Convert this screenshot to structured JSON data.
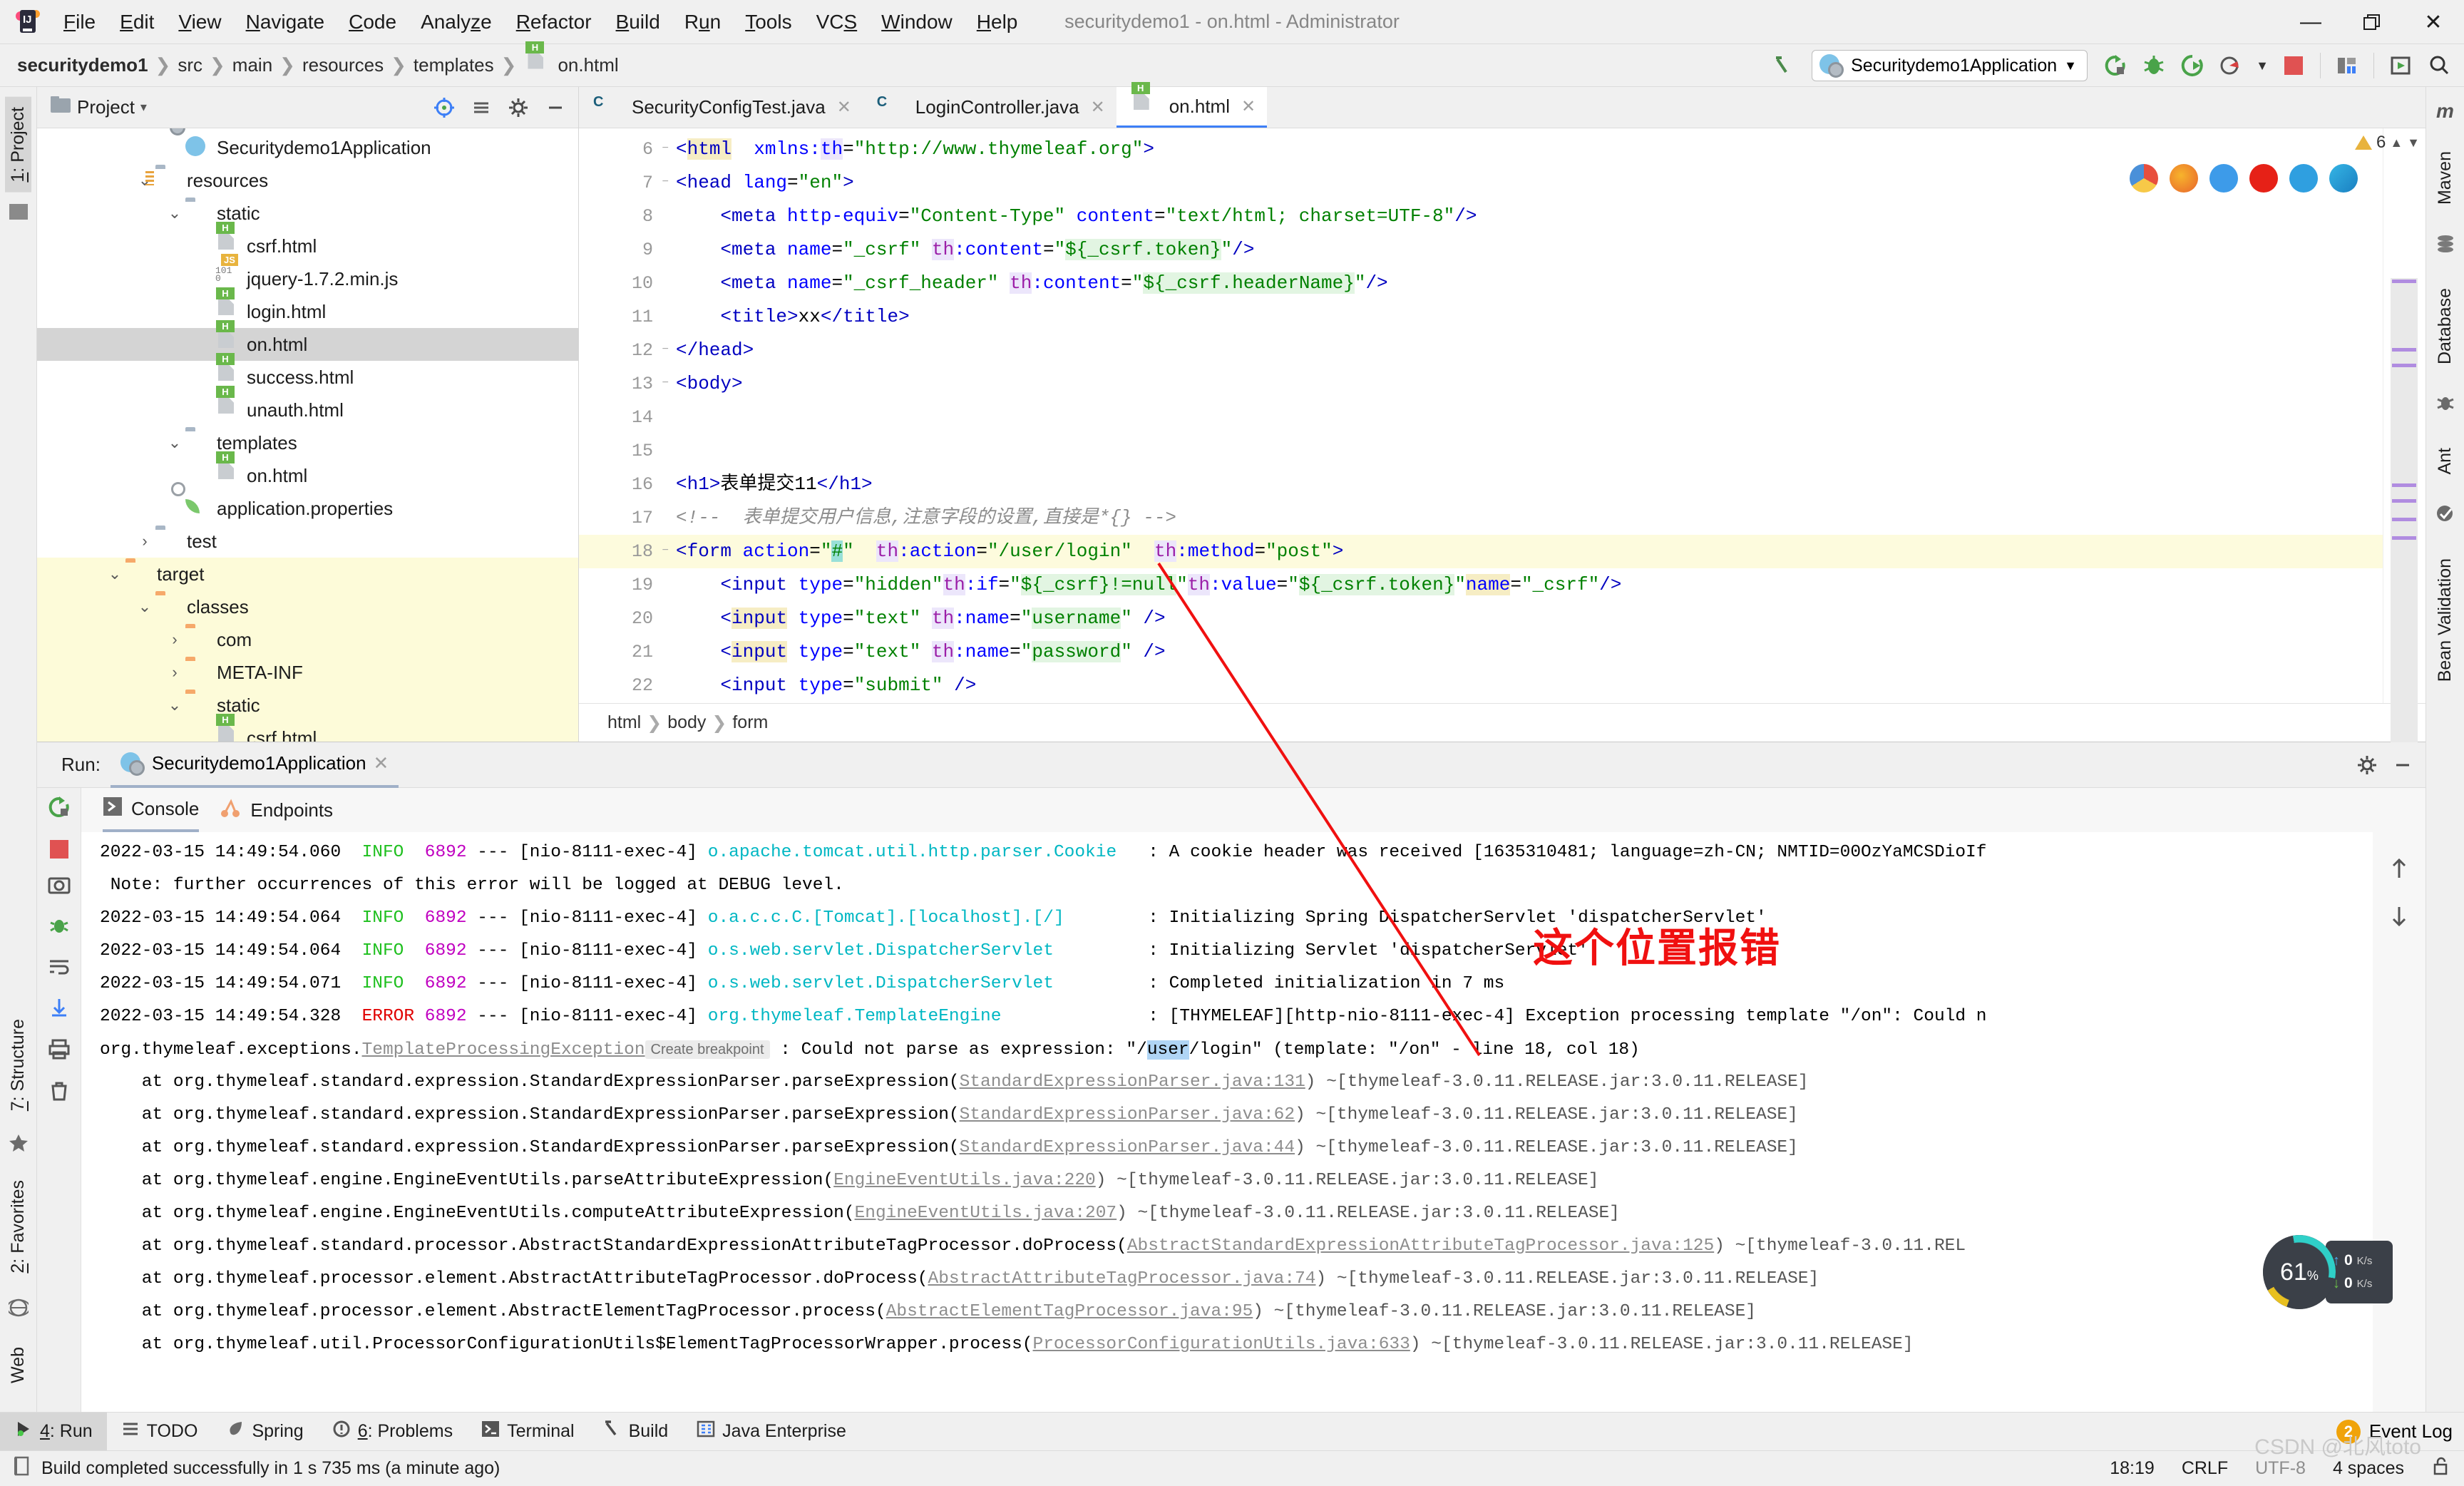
{
  "window": {
    "title": "securitydemo1 - on.html - Administrator",
    "controls": {
      "minimize": "—",
      "maximize": "❐",
      "close": "✕"
    }
  },
  "menubar": [
    {
      "label": "File",
      "mnemonic": "F"
    },
    {
      "label": "Edit",
      "mnemonic": "E"
    },
    {
      "label": "View",
      "mnemonic": "V"
    },
    {
      "label": "Navigate",
      "mnemonic": "N"
    },
    {
      "label": "Code",
      "mnemonic": "C"
    },
    {
      "label": "Analyze",
      "mnemonic": "z"
    },
    {
      "label": "Refactor",
      "mnemonic": "R"
    },
    {
      "label": "Build",
      "mnemonic": "B"
    },
    {
      "label": "Run",
      "mnemonic": "u"
    },
    {
      "label": "Tools",
      "mnemonic": "T"
    },
    {
      "label": "VCS",
      "mnemonic": "S"
    },
    {
      "label": "Window",
      "mnemonic": "W"
    },
    {
      "label": "Help",
      "mnemonic": "H"
    }
  ],
  "navbar": {
    "crumbs": [
      "securitydemo1",
      "src",
      "main",
      "resources",
      "templates",
      "on.html"
    ],
    "separator": "❯",
    "run_config": "Securitydemo1Application",
    "run_config_caret": "▼"
  },
  "project_panel": {
    "title": "Project",
    "title_caret": "▾",
    "tree": [
      {
        "label": "Securitydemo1Application",
        "indent": 4,
        "arrow": "none",
        "icon": "spring-app-icon",
        "state": "normal"
      },
      {
        "label": "resources",
        "indent": 3,
        "arrow": "down",
        "icon": "resources-folder-icon",
        "state": "normal"
      },
      {
        "label": "static",
        "indent": 4,
        "arrow": "down",
        "icon": "folder-icon",
        "state": "normal"
      },
      {
        "label": "csrf.html",
        "indent": 5,
        "arrow": "none",
        "icon": "html-file-icon",
        "state": "normal"
      },
      {
        "label": "jquery-1.7.2.min.js",
        "indent": 5,
        "arrow": "none",
        "icon": "js-file-icon",
        "state": "normal"
      },
      {
        "label": "login.html",
        "indent": 5,
        "arrow": "none",
        "icon": "html-file-icon",
        "state": "normal"
      },
      {
        "label": "on.html",
        "indent": 5,
        "arrow": "none",
        "icon": "html-file-icon",
        "state": "selected"
      },
      {
        "label": "success.html",
        "indent": 5,
        "arrow": "none",
        "icon": "html-file-icon",
        "state": "normal"
      },
      {
        "label": "unauth.html",
        "indent": 5,
        "arrow": "none",
        "icon": "html-file-icon",
        "state": "normal"
      },
      {
        "label": "templates",
        "indent": 4,
        "arrow": "down",
        "icon": "folder-icon",
        "state": "normal"
      },
      {
        "label": "on.html",
        "indent": 5,
        "arrow": "none",
        "icon": "html-file-icon",
        "state": "normal"
      },
      {
        "label": "application.properties",
        "indent": 4,
        "arrow": "none",
        "icon": "spring-properties-icon",
        "state": "normal"
      },
      {
        "label": "test",
        "indent": 3,
        "arrow": "right",
        "icon": "folder-icon",
        "state": "normal"
      },
      {
        "label": "target",
        "indent": 2,
        "arrow": "down",
        "icon": "folder-orange-icon",
        "state": "target"
      },
      {
        "label": "classes",
        "indent": 3,
        "arrow": "down",
        "icon": "folder-orange-icon",
        "state": "target"
      },
      {
        "label": "com",
        "indent": 4,
        "arrow": "right",
        "icon": "folder-orange-icon",
        "state": "target"
      },
      {
        "label": "META-INF",
        "indent": 4,
        "arrow": "right",
        "icon": "folder-orange-icon",
        "state": "target"
      },
      {
        "label": "static",
        "indent": 4,
        "arrow": "down",
        "icon": "folder-orange-icon",
        "state": "target"
      },
      {
        "label": "csrf.html",
        "indent": 5,
        "arrow": "none",
        "icon": "html-file-icon",
        "state": "target"
      }
    ]
  },
  "editor": {
    "tabs": [
      {
        "label": "SecurityConfigTest.java",
        "icon": "java-class-icon",
        "active": false,
        "close": "✕"
      },
      {
        "label": "LoginController.java",
        "icon": "java-class-icon",
        "active": false,
        "close": "✕"
      },
      {
        "label": "on.html",
        "icon": "html-file-icon",
        "active": true,
        "close": "✕"
      }
    ],
    "warning_count": "6",
    "lines": [
      {
        "n": "6",
        "highlight": false
      },
      {
        "n": "7",
        "highlight": false
      },
      {
        "n": "8",
        "highlight": false
      },
      {
        "n": "9",
        "highlight": false
      },
      {
        "n": "10",
        "highlight": false
      },
      {
        "n": "11",
        "highlight": false
      },
      {
        "n": "12",
        "highlight": false
      },
      {
        "n": "13",
        "highlight": false
      },
      {
        "n": "14",
        "highlight": false
      },
      {
        "n": "15",
        "highlight": false
      },
      {
        "n": "16",
        "highlight": false
      },
      {
        "n": "17",
        "highlight": false
      },
      {
        "n": "18",
        "highlight": true
      },
      {
        "n": "19",
        "highlight": false
      },
      {
        "n": "20",
        "highlight": false
      },
      {
        "n": "21",
        "highlight": false
      },
      {
        "n": "22",
        "highlight": false
      }
    ],
    "source": [
      "<html  xmlns:th=\"http://www.thymeleaf.org\">",
      "<head lang=\"en\">",
      "    <meta http-equiv=\"Content-Type\" content=\"text/html; charset=UTF-8\"/>",
      "    <meta name=\"_csrf\" th:content=\"${_csrf.token}\"/>",
      "    <meta name=\"_csrf_header\" th:content=\"${_csrf.headerName}\"/>",
      "    <title>xx</title>",
      "</head>",
      "<body>",
      "",
      "",
      "<h1>表单提交11</h1>",
      "<!--  表单提交用户信息,注意字段的设置,直接是*{} -->",
      "<form action=\"#\"  th:action=\"/user/login\"  th:method=\"post\">",
      "    <input type=\"hidden\"th:if=\"${_csrf}!=null\"th:value=\"${_csrf.token}\"name=\"_csrf\"/>",
      "    <input type=\"text\" th:name=\"username\" />",
      "    <input type=\"text\" th:name=\"password\" />",
      "    <input type=\"submit\" />"
    ],
    "breadcrumbs": [
      "html",
      "body",
      "form"
    ]
  },
  "run_panel": {
    "label": "Run:",
    "config_name": "Securitydemo1Application",
    "close": "✕",
    "tabs": [
      {
        "label": "Console",
        "active": true,
        "icon": "console-icon"
      },
      {
        "label": "Endpoints",
        "active": false,
        "icon": "endpoints-icon"
      }
    ],
    "log": [
      {
        "type": "info",
        "date": "2022-03-15 14:49:54.060",
        "level": "INFO ",
        "pid": "6892",
        "thread": "[nio-8111-exec-4]",
        "logger": "o.apache.tomcat.util.http.parser.Cookie",
        "msg": ": A cookie header was received [1635310481; language=zh-CN; NMTID=00OzYaMCSDioIf"
      },
      {
        "type": "plain",
        "text": " Note: further occurrences of this error will be logged at DEBUG level."
      },
      {
        "type": "info",
        "date": "2022-03-15 14:49:54.064",
        "level": "INFO ",
        "pid": "6892",
        "thread": "[nio-8111-exec-4]",
        "logger": "o.a.c.c.C.[Tomcat].[localhost].[/]",
        "msg": ": Initializing Spring DispatcherServlet 'dispatcherServlet'"
      },
      {
        "type": "info",
        "date": "2022-03-15 14:49:54.064",
        "level": "INFO ",
        "pid": "6892",
        "thread": "[nio-8111-exec-4]",
        "logger": "o.s.web.servlet.DispatcherServlet",
        "msg": ": Initializing Servlet 'dispatcherServlet'"
      },
      {
        "type": "info",
        "date": "2022-03-15 14:49:54.071",
        "level": "INFO ",
        "pid": "6892",
        "thread": "[nio-8111-exec-4]",
        "logger": "o.s.web.servlet.DispatcherServlet",
        "msg": ": Completed initialization in 7 ms"
      },
      {
        "type": "error",
        "date": "2022-03-15 14:49:54.328",
        "level": "ERROR",
        "pid": "6892",
        "thread": "[nio-8111-exec-4]",
        "logger": "org.thymeleaf.TemplateEngine",
        "msg": ": [THYMELEAF][http-nio-8111-exec-4] Exception processing template \"/on\": Could n"
      }
    ],
    "exception": {
      "prefix": "org.thymeleaf.exceptions.",
      "link": "TemplateProcessingException",
      "breakpoint_hint": "Create breakpoint",
      "rest_a": " : Could not parse as expression: \"/",
      "selected": "user",
      "rest_b": "/login\" (template: \"/on\" - line 18, col 18)"
    },
    "stack": [
      {
        "pre": "    at org.thymeleaf.standard.expression.StandardExpressionParser.parseExpression(",
        "link": "StandardExpressionParser.java:131",
        "post": ") ~[thymeleaf-3.0.11.RELEASE.jar:3.0.11.RELEASE]"
      },
      {
        "pre": "    at org.thymeleaf.standard.expression.StandardExpressionParser.parseExpression(",
        "link": "StandardExpressionParser.java:62",
        "post": ") ~[thymeleaf-3.0.11.RELEASE.jar:3.0.11.RELEASE]"
      },
      {
        "pre": "    at org.thymeleaf.standard.expression.StandardExpressionParser.parseExpression(",
        "link": "StandardExpressionParser.java:44",
        "post": ") ~[thymeleaf-3.0.11.RELEASE.jar:3.0.11.RELEASE]"
      },
      {
        "pre": "    at org.thymeleaf.engine.EngineEventUtils.parseAttributeExpression(",
        "link": "EngineEventUtils.java:220",
        "post": ") ~[thymeleaf-3.0.11.RELEASE.jar:3.0.11.RELEASE]"
      },
      {
        "pre": "    at org.thymeleaf.engine.EngineEventUtils.computeAttributeExpression(",
        "link": "EngineEventUtils.java:207",
        "post": ") ~[thymeleaf-3.0.11.RELEASE.jar:3.0.11.RELEASE]"
      },
      {
        "pre": "    at org.thymeleaf.standard.processor.AbstractStandardExpressionAttributeTagProcessor.doProcess(",
        "link": "AbstractStandardExpressionAttributeTagProcessor.java:125",
        "post": ") ~[thymeleaf-3.0.11.REL"
      },
      {
        "pre": "    at org.thymeleaf.processor.element.AbstractAttributeTagProcessor.doProcess(",
        "link": "AbstractAttributeTagProcessor.java:74",
        "post": ") ~[thymeleaf-3.0.11.RELEASE.jar:3.0.11.RELEASE]"
      },
      {
        "pre": "    at org.thymeleaf.processor.element.AbstractElementTagProcessor.process(",
        "link": "AbstractElementTagProcessor.java:95",
        "post": ") ~[thymeleaf-3.0.11.RELEASE.jar:3.0.11.RELEASE]"
      },
      {
        "pre": "    at org.thymeleaf.util.ProcessorConfigurationUtils$ElementTagProcessorWrapper.process(",
        "link": "ProcessorConfigurationUtils.java:633",
        "post": ") ~[thymeleaf-3.0.11.RELEASE.jar:3.0.11.RELEASE]"
      }
    ]
  },
  "left_strip": [
    {
      "label": "1: Project",
      "mnemonic": "1",
      "active": true
    },
    {
      "label": "7: Structure",
      "mnemonic": "7",
      "active": false
    },
    {
      "label": "2: Favorites",
      "mnemonic": "2",
      "active": false
    },
    {
      "label": "Web",
      "mnemonic": "",
      "active": false
    }
  ],
  "right_strip": [
    {
      "label": "Maven",
      "icon": "maven-icon"
    },
    {
      "label": "Database",
      "icon": "database-icon"
    },
    {
      "label": "Ant",
      "icon": "ant-icon"
    },
    {
      "label": "Bean Validation",
      "icon": "bean-validation-icon"
    }
  ],
  "toolwindow_bar": [
    {
      "label": "4: Run",
      "mnemonic": "4",
      "icon": "run-icon",
      "active": true
    },
    {
      "label": "TODO",
      "mnemonic": "",
      "icon": "todo-icon",
      "active": false
    },
    {
      "label": "Spring",
      "mnemonic": "",
      "icon": "spring-icon",
      "active": false
    },
    {
      "label": "6: Problems",
      "mnemonic": "6",
      "icon": "problems-icon",
      "active": false
    },
    {
      "label": "Terminal",
      "mnemonic": "",
      "icon": "terminal-icon",
      "active": false
    },
    {
      "label": "Build",
      "mnemonic": "",
      "icon": "build-icon",
      "active": false
    },
    {
      "label": "Java Enterprise",
      "mnemonic": "",
      "icon": "java-enterprise-icon",
      "active": false
    }
  ],
  "event_log": {
    "count": "2",
    "label": "Event Log"
  },
  "statusbar": {
    "message": "Build completed successfully in 1 s 735 ms (a minute ago)",
    "time": "18:19",
    "line_sep": "CRLF",
    "encoding": "UTF-8",
    "indent": "4 spaces",
    "lock_icon": "unlocked-icon"
  },
  "annotation": {
    "text": "这个位置报错",
    "color": "#f01010"
  },
  "network_widget": {
    "percent": "61",
    "percent_unit": "%",
    "upload": "0",
    "download": "0",
    "unit": "K/s"
  },
  "watermark": "CSDN @北风toto",
  "colors": {
    "accent": "#3d7ff7",
    "error": "#e00000",
    "info": "#20c020",
    "logger": "#00b7c3",
    "annotation": "#f01010",
    "selection": "#b0d5f5",
    "highlight_line": "#fdfbdd"
  }
}
